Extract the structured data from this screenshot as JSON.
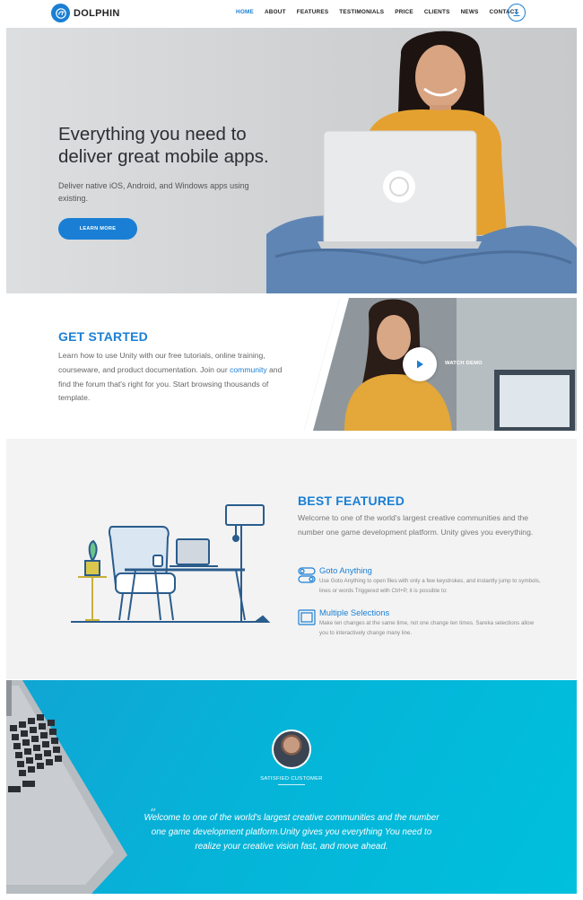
{
  "brand": {
    "name": "DOLPHIN",
    "color": "#1a7fd4"
  },
  "nav": {
    "items": [
      {
        "label": "HOME",
        "active": true
      },
      {
        "label": "ABOUT"
      },
      {
        "label": "FEATURES"
      },
      {
        "label": "TESTIMONIALS"
      },
      {
        "label": "PRICE"
      },
      {
        "label": "CLIENTS"
      },
      {
        "label": "NEWS"
      },
      {
        "label": "CONTACT"
      }
    ],
    "download_icon": "download-icon"
  },
  "hero": {
    "title_line1": "Everything you need to",
    "title_line2": "deliver great mobile apps.",
    "subtitle_line1": "Deliver native iOS, Android, and Windows apps using",
    "subtitle_line2": "existing.",
    "button": "LEARN MORE"
  },
  "get_started": {
    "title_bold": "GET",
    "title_light": "STARTED",
    "text_before_link": "Learn how to use Unity with our free tutorials, online training, courseware, and product documentation. Join our ",
    "link": "community",
    "text_after_link": " and find the forum that's right for you. Start browsing thousands of template.",
    "watch_label": "WATCH DEMO"
  },
  "best_featured": {
    "title_bold": "BEST",
    "title_light": "FEATURED",
    "text": "Welcome to one of the world's largest creative communities and the number one game development platform. Unity gives you everything.",
    "features": [
      {
        "title": "Goto Anything",
        "desc": "Use Goto Anything to open files with only a few keystrokes, and instantly jump to symbols, lines or words Triggered with Ctrl+P, it is possible to:",
        "icon": "toggle-icon"
      },
      {
        "title": "Multiple Selections",
        "desc": "Make ten changes at the same time, not one change ten times. Sareka selections allow you to interactively change many line.",
        "icon": "selection-icon"
      }
    ]
  },
  "testimonial": {
    "label": "SATISFIED CUSTOMER",
    "quote": "Welcome to one of the world's largest creative communities and the number one game development platform.Unity gives you everything You need to realize your creative vision fast, and move ahead."
  }
}
